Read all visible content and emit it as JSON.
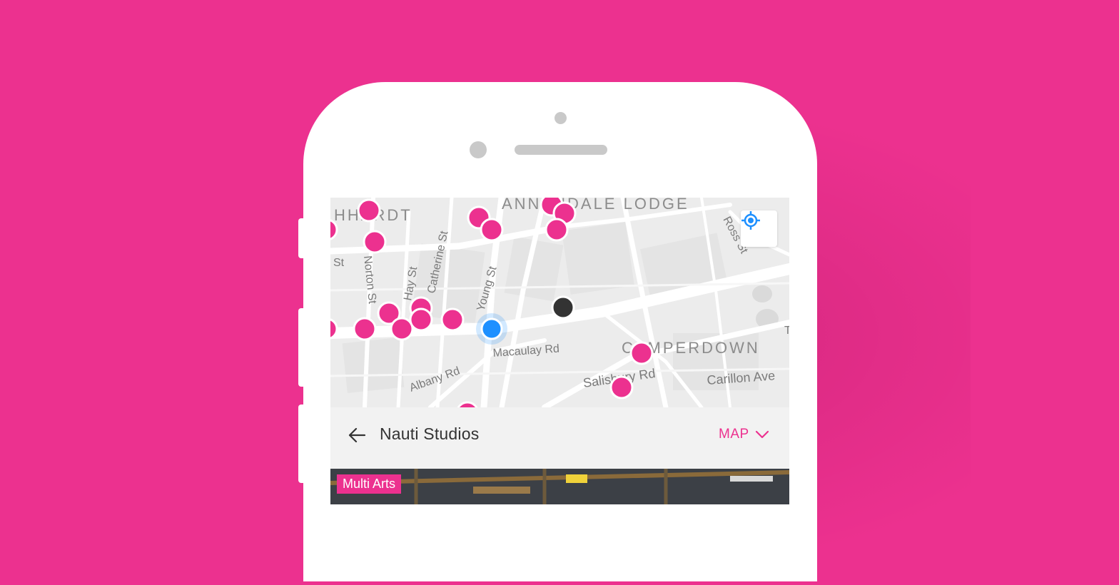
{
  "colors": {
    "background": "#ec318f",
    "accent": "#ec318f",
    "user_location": "#1e90ff",
    "selected_marker": "#333333"
  },
  "map": {
    "area_labels": [
      "HHARDT",
      "ANNANDALE LODGE",
      "CAMPERDOWN"
    ],
    "street_labels": [
      "Norton St",
      "Catherine St",
      "Young St",
      "Hay St",
      "Ross St",
      "Macaulay Rd",
      "Albany Rd",
      "Salisbury Rd",
      "Carillon Ave",
      "St",
      "T"
    ],
    "locate_button_icon": "crosshair-location-icon"
  },
  "header": {
    "back_icon": "arrow-left-icon",
    "title": "Nauti Studios",
    "toggle_label": "MAP",
    "toggle_icon": "chevron-down-icon"
  },
  "photo": {
    "category": "Multi Arts"
  }
}
